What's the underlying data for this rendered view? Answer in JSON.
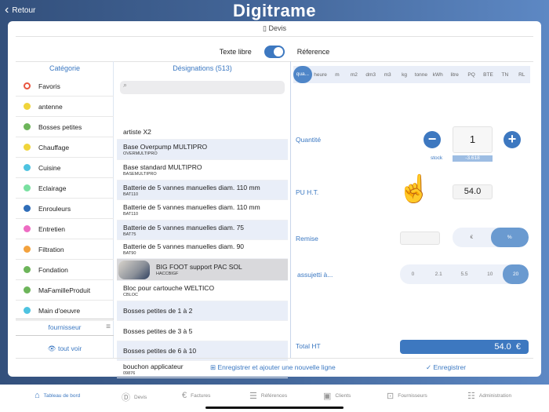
{
  "header": {
    "back_label": "Retour",
    "logo": "Digitrame"
  },
  "card": {
    "title": "Devis",
    "toggle_left": "Texte libre",
    "toggle_right": "Réference",
    "toggle_on": true
  },
  "categories": {
    "title": "Catégorie",
    "items": [
      {
        "label": "Favoris",
        "color": "#e8553f",
        "icon": "heart"
      },
      {
        "label": "antenne",
        "color": "#f0d43a"
      },
      {
        "label": "Bosses petites",
        "color": "#6db55a"
      },
      {
        "label": "Chauffage",
        "color": "#f0d43a"
      },
      {
        "label": "Cuisine",
        "color": "#4ec3e0"
      },
      {
        "label": "Eclairage",
        "color": "#79e0a0"
      },
      {
        "label": "Enrouleurs",
        "color": "#2f6db8"
      },
      {
        "label": "Entretien",
        "color": "#ee6cc3"
      },
      {
        "label": "Filtration",
        "color": "#f3a23d"
      },
      {
        "label": "Fondation",
        "color": "#6db55a"
      },
      {
        "label": "MaFamilleProduit",
        "color": "#6db55a"
      },
      {
        "label": "Main d'oeuvre",
        "color": "#4ec3e0"
      }
    ],
    "fournisseur": "fournisseur",
    "tout_voir": "tout voir"
  },
  "designations": {
    "title": "Désignations (513)",
    "search_placeholder": "",
    "items": [
      {
        "label": "artiste X2",
        "ref": ""
      },
      {
        "label": "Base Overpump MULTIPRO",
        "ref": "OVERMULTIPRO"
      },
      {
        "label": "Base standard MULTIPRO",
        "ref": "BASEMULTIPRO"
      },
      {
        "label": "Batterie de 5 vannes manuelles diam. 110 mm",
        "ref": "BAT110"
      },
      {
        "label": "Batterie de 5 vannes manuelles diam. 110 mm",
        "ref": "BAT110"
      },
      {
        "label": "Batterie de 5 vannes manuelles diam. 75",
        "ref": "BAT75"
      },
      {
        "label": "Batterie de 5 vannes manuelles diam. 90",
        "ref": "BAT90"
      },
      {
        "label": "BIG FOOT support PAC SOL",
        "ref": "HACCBIGF",
        "selected": true
      },
      {
        "label": "Bloc pour cartouche WELTICO",
        "ref": "CBLOC"
      },
      {
        "label": "Bosses petites de 1 à 2",
        "ref": ""
      },
      {
        "label": "Bosses petites de 3 à 5",
        "ref": ""
      },
      {
        "label": "Bosses petites de 6 à 10",
        "ref": ""
      },
      {
        "label": "bouchon applicateur",
        "ref": "09876"
      }
    ]
  },
  "detail": {
    "units": [
      "qua...",
      "heure",
      "m",
      "m2",
      "dm3",
      "m3",
      "kg",
      "tonne",
      "kWh",
      "litre",
      "PQ",
      "BTE",
      "TN",
      "RL"
    ],
    "selected_unit": "qua...",
    "quantite_label": "Quantité",
    "quantite": "1",
    "stock_label": "stock",
    "stock": "-3.618",
    "pu_label": "PU H.T.",
    "pu": "54.0",
    "remise_label": "Remise",
    "remise_value": "",
    "remise_modes": [
      "€",
      "%"
    ],
    "remise_selected": "%",
    "tva_label": "assujetti à...",
    "tva_options": [
      "0",
      "2.1",
      "5.5",
      "10",
      "20"
    ],
    "tva_selected": "20",
    "total_label": "Total HT",
    "total": "54.0  €"
  },
  "footer": {
    "add_line": "Enregistrer et ajouter une nouvelle ligne",
    "save": "Enregistrer"
  },
  "tabbar": [
    {
      "label": "Tableau de bord",
      "active": true
    },
    {
      "label": "Devis"
    },
    {
      "label": "Factures"
    },
    {
      "label": "Références"
    },
    {
      "label": "Clients"
    },
    {
      "label": "Fournisseurs"
    },
    {
      "label": "Administration"
    }
  ],
  "colors": {
    "accent": "#3d78c0",
    "row_alt": "#e9eef8"
  }
}
